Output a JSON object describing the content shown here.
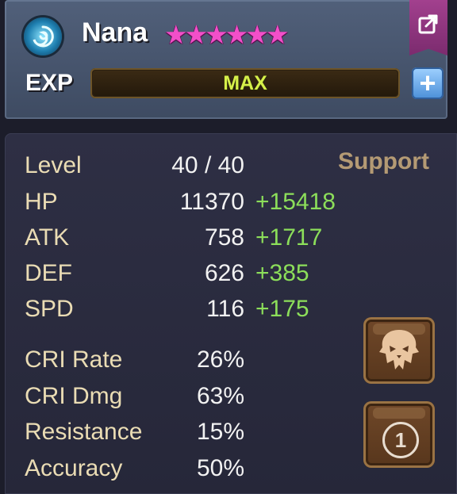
{
  "monster": {
    "name": "Nana",
    "element_icon": "water-swirl-icon",
    "stars": [
      "★",
      "★",
      "★",
      "★",
      "★",
      "★"
    ],
    "star_color": "#f24fc9"
  },
  "exp": {
    "label": "EXP",
    "status": "MAX",
    "fill_fraction": 1.0,
    "plus_label": "+"
  },
  "actions": {
    "share_icon": "share-arrow-icon",
    "skull_icon": "skull-mask-icon",
    "rune_slot_label": "1"
  },
  "stats": {
    "role": "Support",
    "level": {
      "label": "Level",
      "value": "40 / 40"
    },
    "base": [
      {
        "label": "HP",
        "value": "11370",
        "bonus": "+15418"
      },
      {
        "label": "ATK",
        "value": "758",
        "bonus": "+1717"
      },
      {
        "label": "DEF",
        "value": "626",
        "bonus": "+385"
      },
      {
        "label": "SPD",
        "value": "116",
        "bonus": "+175"
      }
    ],
    "secondary": [
      {
        "label": "CRI Rate",
        "value": "26%"
      },
      {
        "label": "CRI Dmg",
        "value": "63%"
      },
      {
        "label": "Resistance",
        "value": "15%"
      },
      {
        "label": "Accuracy",
        "value": "50%"
      }
    ]
  },
  "colors": {
    "label": "#eadcb4",
    "bonus": "#8cde5a",
    "exp_text": "#d6f04a",
    "role": "#b49a74"
  }
}
